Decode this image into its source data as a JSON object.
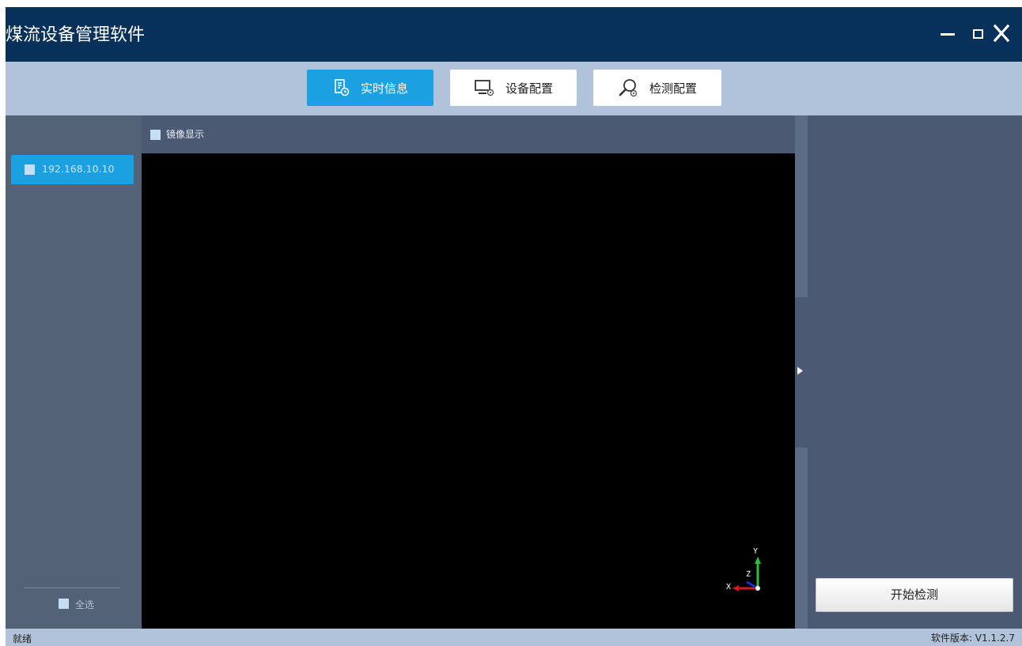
{
  "window": {
    "title": "煤流设备管理软件",
    "controls": [
      "minimize-icon",
      "maximize-icon",
      "close-icon"
    ]
  },
  "toolbar": {
    "tabs": [
      {
        "label": "实时信息",
        "icon": "report-clock-icon",
        "active": true
      },
      {
        "label": "设备配置",
        "icon": "monitor-gear-icon",
        "active": false
      },
      {
        "label": "检测配置",
        "icon": "magnifier-gear-icon",
        "active": false
      }
    ]
  },
  "sidebar": {
    "devices": [
      {
        "ip": "192.168.10.10",
        "checked": false
      }
    ],
    "select_all_label": "全选"
  },
  "viewer": {
    "mirror_label": "镜像显示",
    "axes": {
      "x": "X",
      "y": "Y",
      "z": "Z"
    }
  },
  "right_panel": {
    "start_button": "开始检测"
  },
  "status": {
    "left": "就绪",
    "version": "软件版本: V1.1.2.7"
  },
  "colors": {
    "title_bar": "#073159",
    "toolbar": "#b1c3db",
    "accent": "#1ba1e2",
    "panel": "#4b5a72",
    "checkbox": "#c5dff2"
  }
}
